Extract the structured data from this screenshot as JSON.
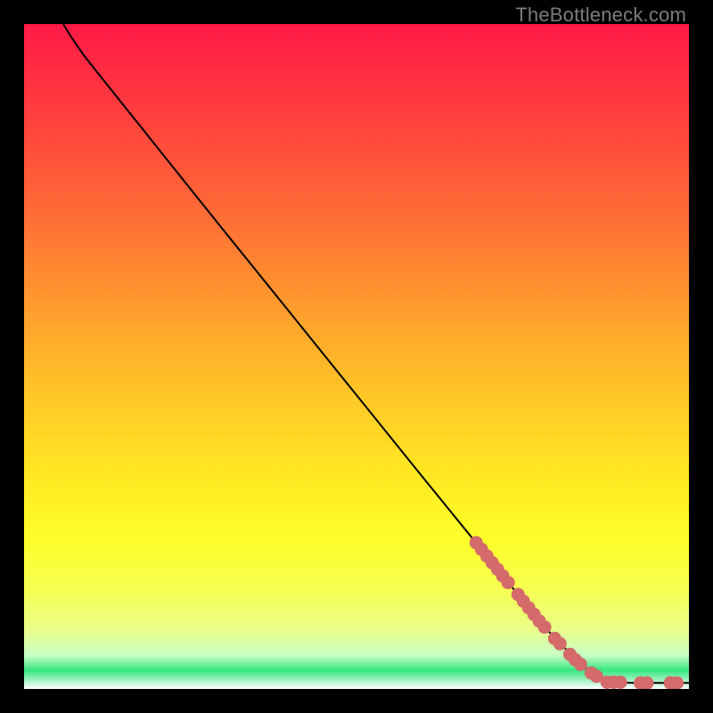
{
  "watermark": "TheBottleneck.com",
  "colors": {
    "frame": "#000000",
    "curve": "#000000",
    "marker": "#d46a6a",
    "gradient_top": "#ff1a46",
    "gradient_mid": "#fff025",
    "gradient_green": "#36e57e",
    "gradient_bottom": "#ffffff"
  },
  "chart_data": {
    "type": "line",
    "title": "",
    "xlabel": "",
    "ylabel": "",
    "xlim": [
      0,
      100
    ],
    "ylim": [
      0,
      100
    ],
    "curve": [
      {
        "x": 5.9,
        "y": 100.0
      },
      {
        "x": 7.0,
        "y": 98.2
      },
      {
        "x": 9.0,
        "y": 95.3
      },
      {
        "x": 12.0,
        "y": 91.5
      },
      {
        "x": 16.0,
        "y": 86.5
      },
      {
        "x": 22.0,
        "y": 79.0
      },
      {
        "x": 30.0,
        "y": 69.0
      },
      {
        "x": 40.0,
        "y": 56.6
      },
      {
        "x": 50.0,
        "y": 44.2
      },
      {
        "x": 60.0,
        "y": 31.8
      },
      {
        "x": 70.0,
        "y": 19.5
      },
      {
        "x": 78.0,
        "y": 9.6
      },
      {
        "x": 84.0,
        "y": 3.4
      },
      {
        "x": 86.5,
        "y": 1.6
      },
      {
        "x": 88.0,
        "y": 1.0
      },
      {
        "x": 92.0,
        "y": 0.9
      },
      {
        "x": 97.0,
        "y": 0.9
      },
      {
        "x": 100.0,
        "y": 0.9
      }
    ],
    "markers_diagonal_band": [
      {
        "x": 68.0,
        "y": 22.0
      },
      {
        "x": 68.8,
        "y": 21.0
      },
      {
        "x": 69.6,
        "y": 20.0
      },
      {
        "x": 70.4,
        "y": 19.0
      },
      {
        "x": 71.2,
        "y": 18.0
      },
      {
        "x": 72.0,
        "y": 17.0
      },
      {
        "x": 72.8,
        "y": 16.0
      },
      {
        "x": 74.3,
        "y": 14.2
      },
      {
        "x": 75.1,
        "y": 13.2
      },
      {
        "x": 75.9,
        "y": 12.2
      },
      {
        "x": 76.7,
        "y": 11.2
      },
      {
        "x": 77.5,
        "y": 10.2
      },
      {
        "x": 78.3,
        "y": 9.3
      },
      {
        "x": 79.8,
        "y": 7.6
      },
      {
        "x": 80.6,
        "y": 6.8
      },
      {
        "x": 82.1,
        "y": 5.2
      },
      {
        "x": 82.9,
        "y": 4.4
      },
      {
        "x": 83.7,
        "y": 3.7
      },
      {
        "x": 85.3,
        "y": 2.4
      },
      {
        "x": 86.1,
        "y": 1.9
      }
    ],
    "markers_bottom_row": [
      {
        "x": 87.7,
        "y": 1.0
      },
      {
        "x": 88.7,
        "y": 1.0
      },
      {
        "x": 89.7,
        "y": 1.0
      },
      {
        "x": 92.7,
        "y": 0.9
      },
      {
        "x": 93.7,
        "y": 0.9
      },
      {
        "x": 97.2,
        "y": 0.9
      },
      {
        "x": 98.2,
        "y": 0.9
      }
    ],
    "marker_radius": 1.0
  }
}
